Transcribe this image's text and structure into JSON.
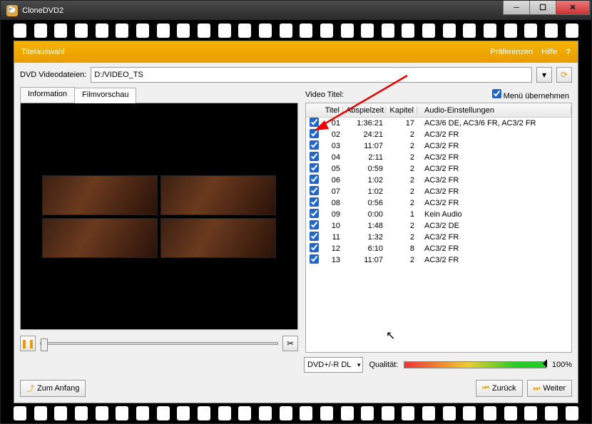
{
  "window": {
    "title": "CloneDVD2"
  },
  "header": {
    "title": "Titelauswahl",
    "prefs": "Präferenzen",
    "help": "Hilfe"
  },
  "path": {
    "label": "DVD Videodateien:",
    "value": "D:/VIDEO_TS"
  },
  "tabs": {
    "info": "Information",
    "preview": "Filmvorschau"
  },
  "video": {
    "label": "Video Titel:",
    "menu_cb": "Menü übernehmen",
    "cols": {
      "titel": "Titel",
      "abspielzeit": "Abspielzeit",
      "kapitel": "Kapitel",
      "audio": "Audio-Einstellungen"
    },
    "rows": [
      {
        "chk": true,
        "t": "01",
        "time": "1:36:21",
        "k": "17",
        "a": "AC3/6 DE, AC3/6 FR, AC3/2 FR"
      },
      {
        "chk": true,
        "t": "02",
        "time": "24:21",
        "k": "2",
        "a": "AC3/2 FR"
      },
      {
        "chk": true,
        "t": "03",
        "time": "11:07",
        "k": "2",
        "a": "AC3/2 FR"
      },
      {
        "chk": true,
        "t": "04",
        "time": "2:11",
        "k": "2",
        "a": "AC3/2 FR"
      },
      {
        "chk": true,
        "t": "05",
        "time": "0:59",
        "k": "2",
        "a": "AC3/2 FR"
      },
      {
        "chk": true,
        "t": "06",
        "time": "1:02",
        "k": "2",
        "a": "AC3/2 FR"
      },
      {
        "chk": true,
        "t": "07",
        "time": "1:02",
        "k": "2",
        "a": "AC3/2 FR"
      },
      {
        "chk": true,
        "t": "08",
        "time": "0:56",
        "k": "2",
        "a": "AC3/2 FR"
      },
      {
        "chk": true,
        "t": "09",
        "time": "0:00",
        "k": "1",
        "a": "Kein Audio"
      },
      {
        "chk": true,
        "t": "10",
        "time": "1:48",
        "k": "2",
        "a": "AC3/2 DE"
      },
      {
        "chk": true,
        "t": "11",
        "time": "1:32",
        "k": "2",
        "a": "AC3/2 FR"
      },
      {
        "chk": true,
        "t": "12",
        "time": "6:10",
        "k": "8",
        "a": "AC3/2 FR"
      },
      {
        "chk": true,
        "t": "13",
        "time": "11:07",
        "k": "2",
        "a": "AC3/2 FR"
      }
    ]
  },
  "bottom": {
    "media": "DVD+/-R DL",
    "quality_label": "Qualität:",
    "quality_pct": "100%"
  },
  "nav": {
    "start": "Zum Anfang",
    "back": "Zurück",
    "next": "Weiter"
  }
}
